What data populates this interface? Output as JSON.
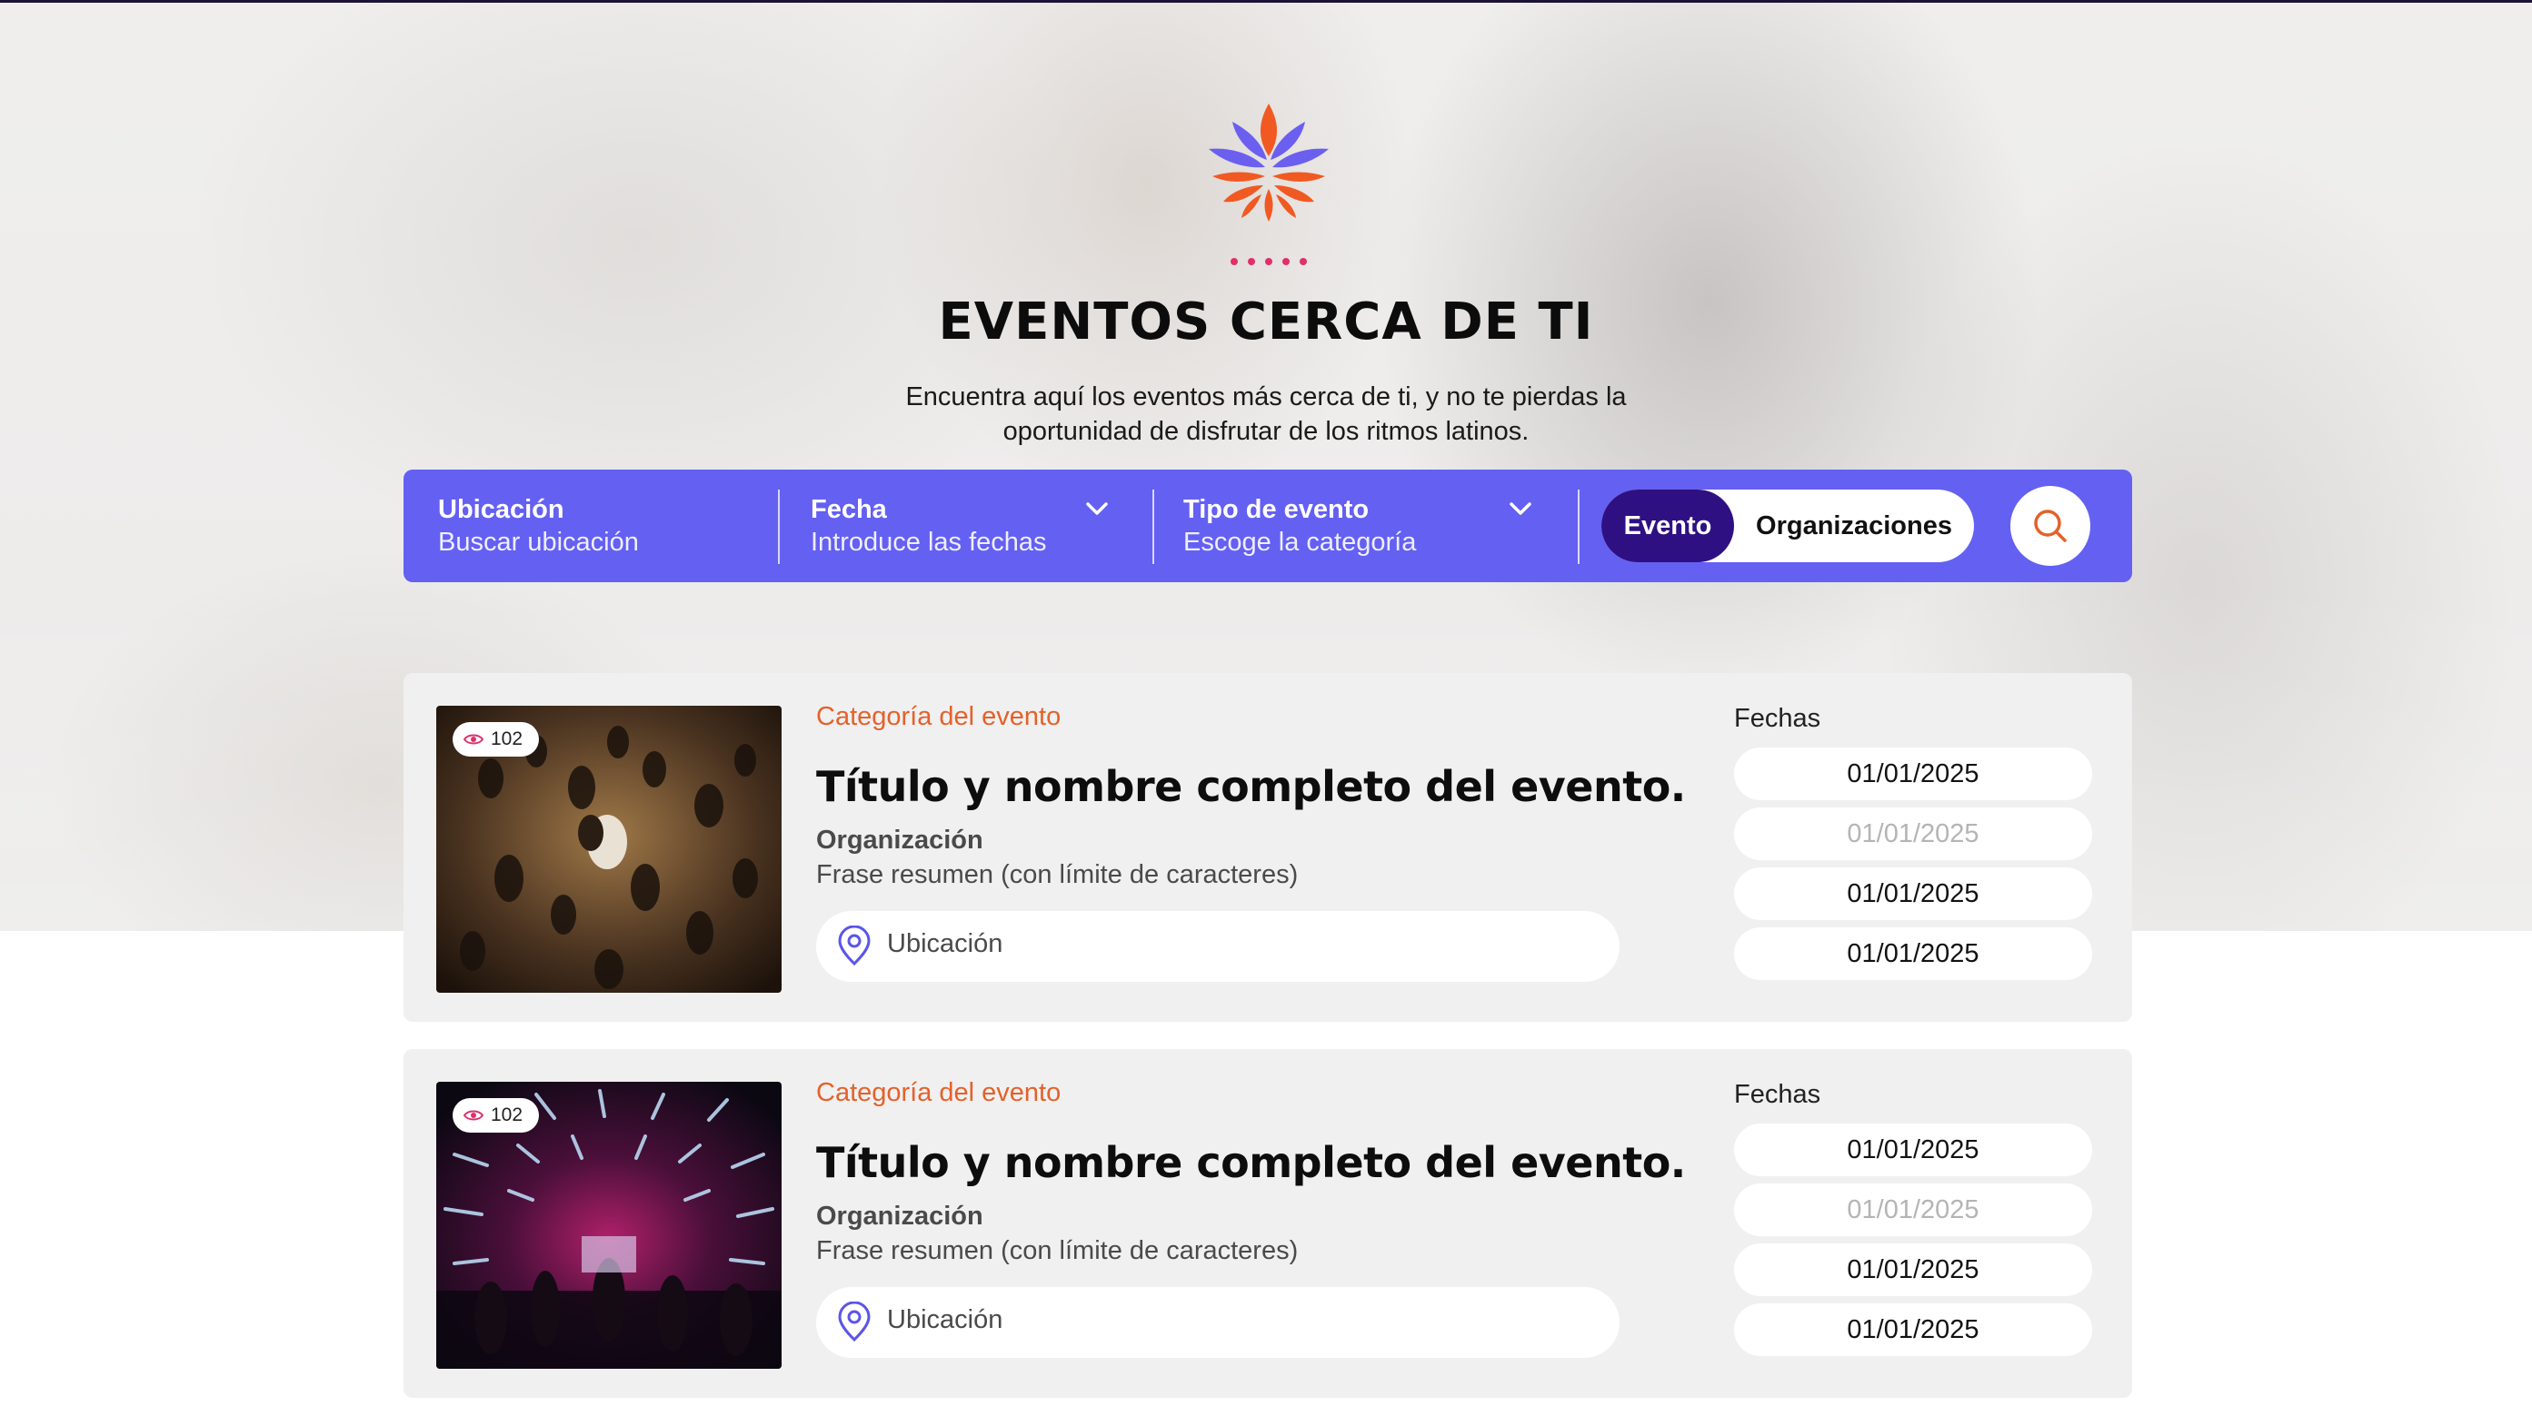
{
  "header": {
    "title": "EVENTOS CERCA DE TI",
    "subtitle_line1": "Encuentra aquí los eventos más cerca de ti, y no te pierdas la",
    "subtitle_line2": "oportunidad de disfrutar de los ritmos latinos."
  },
  "search": {
    "location": {
      "label": "Ubicación",
      "placeholder": "Buscar ubicación"
    },
    "date": {
      "label": "Fecha",
      "placeholder": "Introduce las fechas"
    },
    "type": {
      "label": "Tipo de evento",
      "placeholder": "Escoge la categoría"
    },
    "toggle": {
      "selected": "Evento",
      "other": "Organizaciones"
    }
  },
  "events": [
    {
      "views": "102",
      "category": "Categoría del evento",
      "title": "Título y nombre completo del evento.",
      "organization": "Organización",
      "summary": "Frase resumen (con límite de caracteres)",
      "location": "Ubicación",
      "dates_label": "Fechas",
      "dates": [
        "01/01/2025",
        "01/01/2025",
        "01/01/2025",
        "01/01/2025"
      ],
      "image": "dance-party-photo"
    },
    {
      "views": "102",
      "category": "Categoría del evento",
      "title": "Título y nombre completo del evento.",
      "organization": "Organización",
      "summary": "Frase resumen (con límite de caracteres)",
      "location": "Ubicación",
      "dates_label": "Fechas",
      "dates": [
        "01/01/2025",
        "01/01/2025",
        "01/01/2025",
        "01/01/2025"
      ],
      "image": "nightclub-photo"
    }
  ],
  "colors": {
    "accent": "#6460f2",
    "toggle_active": "#2f1082",
    "category": "#e4612a",
    "logo_orange": "#f05a22",
    "logo_purple": "#6b5ff0",
    "logo_pink": "#e0306a"
  }
}
